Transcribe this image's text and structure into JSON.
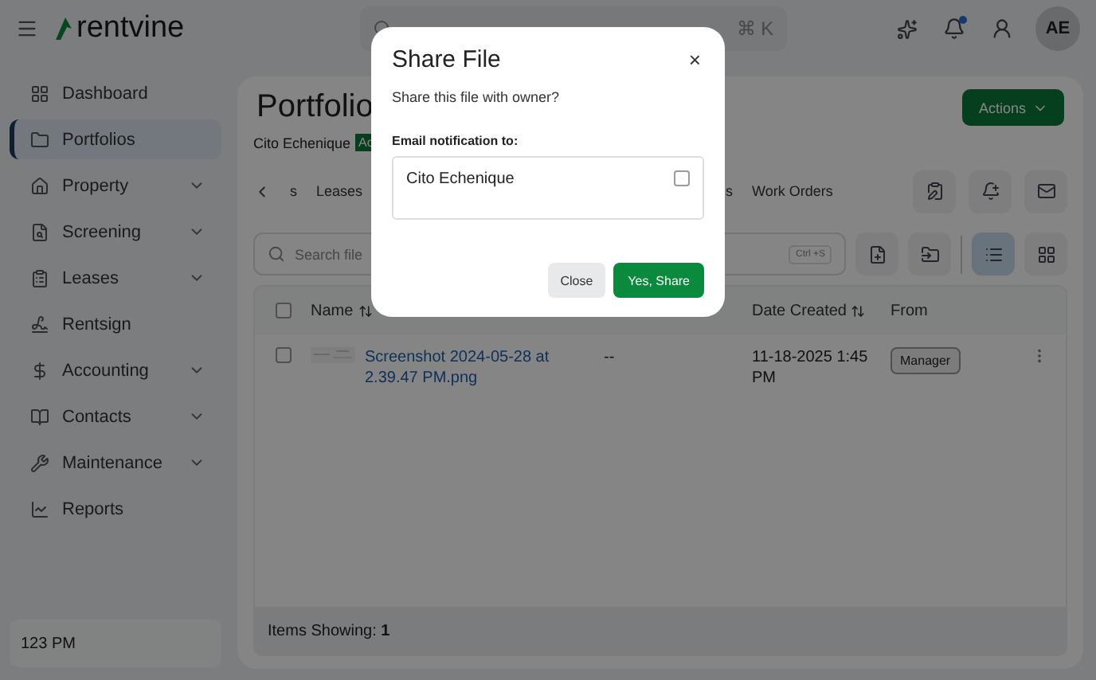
{
  "topbar": {
    "brand": "rentvine",
    "search": {
      "shortcut": "⌘ K"
    },
    "notifications_unread": true,
    "avatar": "AE"
  },
  "sidebar": {
    "items": [
      {
        "label": "Dashboard",
        "expandable": false,
        "selected": false
      },
      {
        "label": "Portfolios",
        "expandable": false,
        "selected": true
      },
      {
        "label": "Property",
        "expandable": true,
        "selected": false
      },
      {
        "label": "Screening",
        "expandable": true,
        "selected": false
      },
      {
        "label": "Leases",
        "expandable": true,
        "selected": false
      },
      {
        "label": "Rentsign",
        "expandable": false,
        "selected": false
      },
      {
        "label": "Accounting",
        "expandable": true,
        "selected": false
      },
      {
        "label": "Contacts",
        "expandable": true,
        "selected": false
      },
      {
        "label": "Maintenance",
        "expandable": true,
        "selected": false
      },
      {
        "label": "Reports",
        "expandable": false,
        "selected": false
      }
    ],
    "footer": "123 PM"
  },
  "page": {
    "title": "Portfolio",
    "owner": "Cito Echenique",
    "status": "Ac",
    "actions": "Actions",
    "tabs": [
      {
        "label": "s",
        "selected": false
      },
      {
        "label": "Leases",
        "selected": false
      },
      {
        "label": "s",
        "selected": false
      },
      {
        "label": "Work Orders",
        "selected": false
      }
    ],
    "file_search": {
      "placeholder": "Search file",
      "shortcut": "Ctrl +S"
    },
    "views": [
      {
        "kind": "list",
        "selected": true
      },
      {
        "kind": "grid",
        "selected": false
      }
    ],
    "table": {
      "all_checked": false,
      "columns": [
        "Name",
        "Date Created",
        "From"
      ],
      "rows": [
        {
          "checked": false,
          "name": "Screenshot 2024-05-28 at 2.39.47 PM.png",
          "column_3": "--",
          "date": "11-18-2025 1:45 PM",
          "from": "Manager"
        }
      ]
    },
    "footer": "Items Showing: **1**"
  },
  "dialog": {
    "title": "Share File",
    "close": "×",
    "question": "Share this file with owner?",
    "label": "Email notification to:",
    "recipients": [
      {
        "name": "Cito Echenique",
        "checked": false
      }
    ],
    "buttons": [
      {
        "label": "Close",
        "kind": "secondary"
      },
      {
        "label": "Yes, Share",
        "kind": "primary"
      }
    ]
  }
}
